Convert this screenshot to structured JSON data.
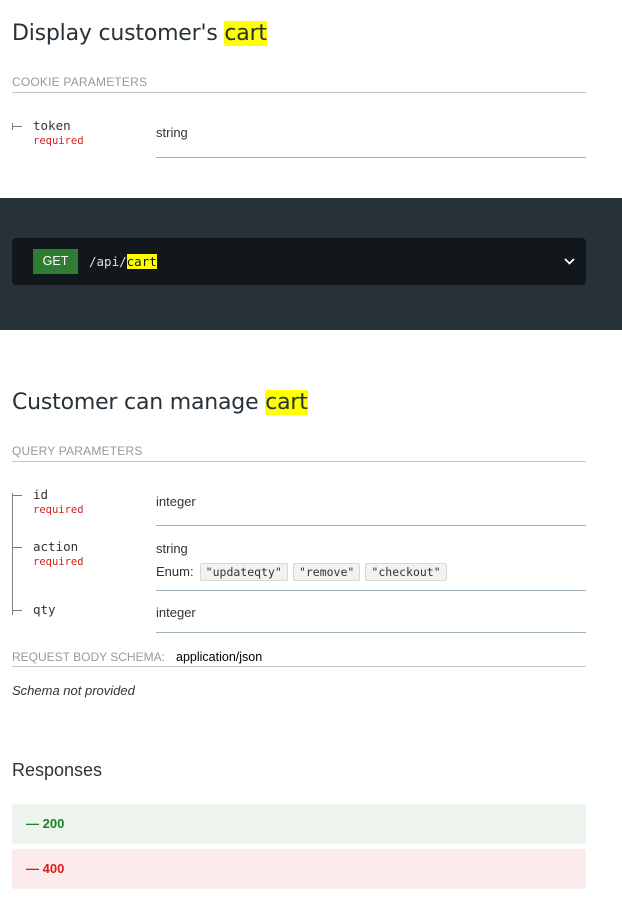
{
  "section1": {
    "title_prefix": "Display customer's ",
    "title_highlight": "cart",
    "params_label": "COOKIE PARAMETERS",
    "params": [
      {
        "name": "token",
        "required": "required",
        "type": "string"
      }
    ]
  },
  "endpoint": {
    "method": "GET",
    "path_prefix": "/api/",
    "path_highlight": "cart",
    "expand_icon": "chevron-down-icon"
  },
  "section2": {
    "title_prefix": "Customer can manage ",
    "title_highlight": "cart",
    "params_label": "QUERY PARAMETERS",
    "params": [
      {
        "name": "id",
        "required": "required",
        "type": "integer"
      },
      {
        "name": "action",
        "required": "required",
        "type": "string",
        "enum_label": "Enum:",
        "enum_values": [
          "\"updateqty\"",
          "\"remove\"",
          "\"checkout\""
        ]
      },
      {
        "name": "qty",
        "type": "integer"
      }
    ],
    "request_body_label": "REQUEST BODY SCHEMA:",
    "request_body_type": "application/json",
    "schema_note": "Schema not provided"
  },
  "responses": {
    "title": "Responses",
    "items": [
      {
        "code": "— 200",
        "status_color": "#1d8127"
      },
      {
        "code": "— 400",
        "status_color": "#d41f1c"
      }
    ]
  },
  "colors": {
    "highlight": "#ffff00",
    "dark_panel": "#263238",
    "get_badge": "#2e7d32",
    "required": "#d41f1c"
  }
}
